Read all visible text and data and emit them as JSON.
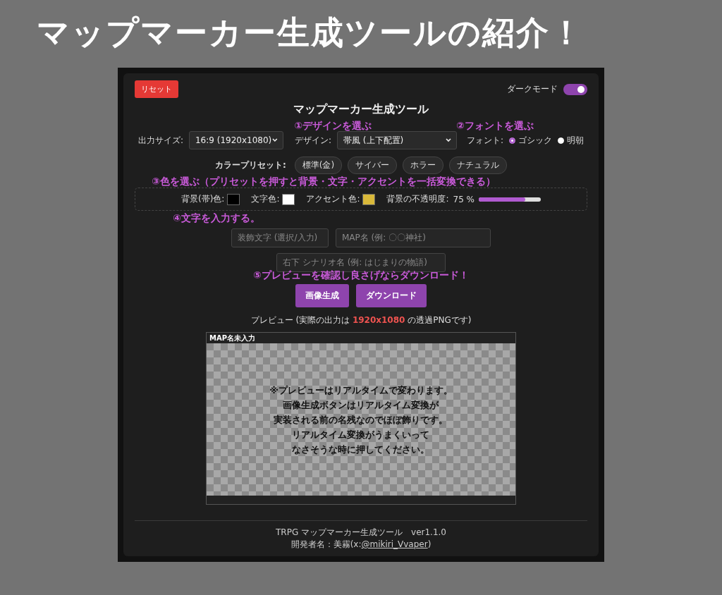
{
  "slide_title": "マップマーカー生成ツールの紹介！",
  "app": {
    "reset_button": "リセット",
    "dark_mode": {
      "label": "ダークモード",
      "on": true
    },
    "title": "マップマーカー生成ツール",
    "annotations": [
      "①デザインを選ぶ",
      "②フォントを選ぶ",
      "③色を選ぶ（プリセットを押すと背景・文字・アクセントを一括変換できる）",
      "④文字を入力する。",
      "⑤プレビューを確認し良さげならダウンロード！"
    ],
    "output_size": {
      "label": "出力サイズ:",
      "value": "16:9 (1920x1080)"
    },
    "design": {
      "label": "デザイン:",
      "value": "帯風 (上下配置)"
    },
    "font": {
      "label": "フォント:",
      "options": [
        {
          "label": "ゴシック",
          "selected": true
        },
        {
          "label": "明朝",
          "selected": false
        }
      ]
    },
    "color_presets": {
      "label": "カラープリセット:",
      "items": [
        "標準(金)",
        "サイバー",
        "ホラー",
        "ナチュラル"
      ]
    },
    "colors": [
      {
        "label": "背景(帯)色:",
        "color": "#000000"
      },
      {
        "label": "文字色:",
        "color": "#ffffff"
      },
      {
        "label": "アクセント色:",
        "color": "#d9b93a"
      }
    ],
    "opacity": {
      "label": "背景の不透明度:",
      "reading": "75 %",
      "level": 0.75
    },
    "fields": [
      {
        "placeholder": "装飾文字 (選択/入力)"
      },
      {
        "placeholder": "MAP名 (例: 〇〇神社)"
      },
      {
        "placeholder": "右下 シナリオ名 (例: はじまりの物語)"
      }
    ],
    "buttons": [
      "画像生成",
      "ダウンロード"
    ],
    "preview_caption": {
      "before": "プレビュー (実際の出力は ",
      "highlight": "1920x1080",
      "after": " の透過PNGです)"
    },
    "preview": {
      "band_text": "MAP名未入力",
      "note_lines": [
        "※プレビューはリアルタイムで変わります。",
        "画像生成ボタンはリアルタイム変換が",
        "実装される前の名残なのでほぼ飾りです。",
        "リアルタイム変換がうまくいって",
        "なさそうな時に押してください。"
      ]
    },
    "footer": {
      "line1": "TRPG マップマーカー生成ツール　ver1.1.0",
      "line2_prefix": "開発者名：美霧(x:",
      "link": "@mikiri_Vvaper",
      "line2_suffix": ")"
    }
  }
}
